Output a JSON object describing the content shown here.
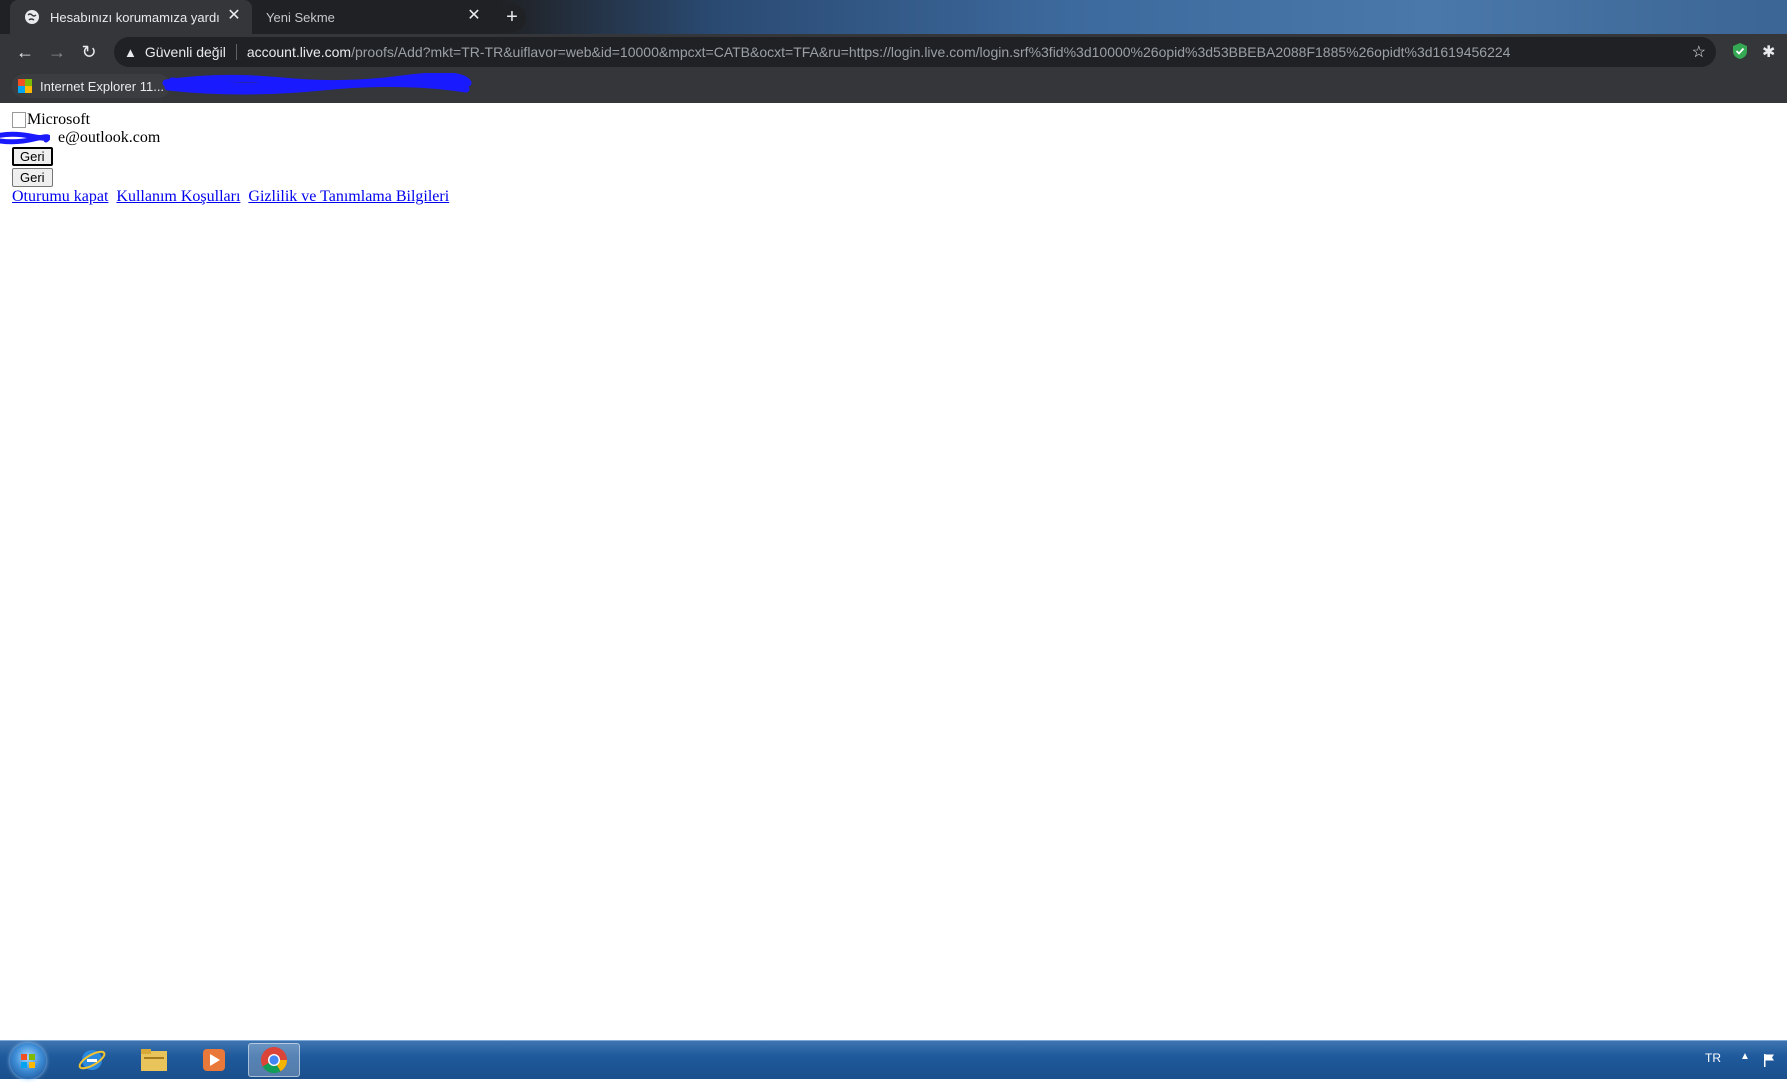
{
  "browser": {
    "tabs": [
      {
        "title": "Hesabınızı korumamıza yardımcı",
        "icon": "globe-icon",
        "active": true
      },
      {
        "title": "Yeni Sekme",
        "icon": "",
        "active": false
      }
    ],
    "security_label": "Güvenli değil",
    "url_domain": "account.live.com",
    "url_path": "/proofs/Add?mkt=TR-TR&uiflavor=web&id=10000&mpcxt=CATB&ocxt=TFA&ru=https://login.live.com/login.srf%3fid%3d10000%26opid%3d53BBEBA2088F1885%26opidt%3d1619456224",
    "bookmarks": [
      {
        "label": "Internet Explorer 11..."
      }
    ]
  },
  "page": {
    "logo_alt": "Microsoft",
    "email_visible": "e@outlook.com",
    "buttons": [
      {
        "label": "Geri"
      },
      {
        "label": "Geri"
      }
    ],
    "links": [
      {
        "label": "Oturumu kapat"
      },
      {
        "label": "Kullanım Koşulları"
      },
      {
        "label": "Gizlilik ve Tanımlama Bilgileri"
      }
    ]
  },
  "taskbar": {
    "language": "TR",
    "apps": [
      "windows-start-icon",
      "internet-explorer-icon",
      "file-explorer-icon",
      "media-player-icon",
      "chrome-icon"
    ]
  },
  "colors": {
    "link": "#0000ee",
    "chrome_dark": "#35363a",
    "omnibox": "#202124",
    "taskbar": "#1f5a9c"
  }
}
